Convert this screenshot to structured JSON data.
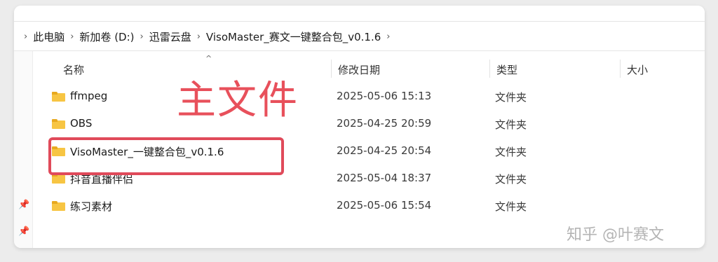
{
  "breadcrumb": [
    "此电脑",
    "新加卷 (D:)",
    "迅雷云盘",
    "VisoMaster_赛文一键整合包_v0.1.6"
  ],
  "columns": {
    "name": "名称",
    "modified": "修改日期",
    "type": "类型",
    "size": "大小"
  },
  "files": [
    {
      "name": "ffmpeg",
      "modified": "2025-05-06 15:13",
      "type": "文件夹"
    },
    {
      "name": "OBS",
      "modified": "2025-04-25 20:59",
      "type": "文件夹"
    },
    {
      "name": "VisoMaster_一键整合包_v0.1.6",
      "modified": "2025-04-25 20:54",
      "type": "文件夹"
    },
    {
      "name": "抖音直播伴侣",
      "modified": "2025-05-04 18:37",
      "type": "文件夹"
    },
    {
      "name": "练习素材",
      "modified": "2025-05-06 15:54",
      "type": "文件夹"
    }
  ],
  "annotation": {
    "text": "主文件",
    "color": "#e8505b"
  },
  "watermark": "知乎 @叶赛文",
  "icons": {
    "folder": "folder-icon",
    "pin": "pin-icon",
    "chevron": "chevron-right-icon",
    "sort": "sort-up-icon"
  }
}
